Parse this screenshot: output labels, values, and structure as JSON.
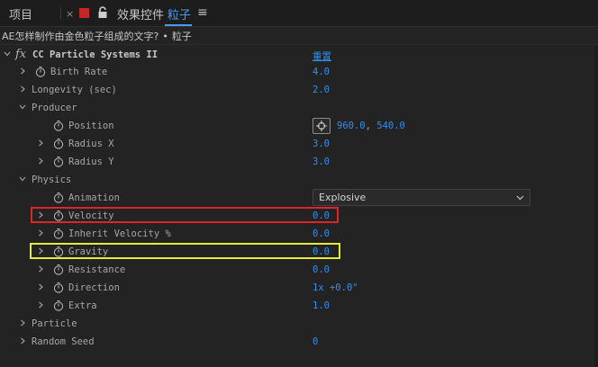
{
  "tabs": {
    "project": "项目",
    "close": "×",
    "effects": "效果控件",
    "layer": "粒子",
    "menu": "≡"
  },
  "breadcrumb": {
    "composition": "AE怎样制作由金色粒子组成的文字?",
    "separator": "•",
    "layer": "粒子"
  },
  "effect": {
    "name": "CC Particle Systems II",
    "reset": "重置",
    "fx": "fx"
  },
  "rows": [
    {
      "label": "Birth Rate",
      "value": "4.0"
    },
    {
      "label": "Longevity (sec)",
      "value": "2.0"
    },
    {
      "label": "Producer"
    },
    {
      "label": "Position",
      "value_x": "960.0",
      "value_comma": ",",
      "value_y": "540.0"
    },
    {
      "label": "Radius X",
      "value": "3.0"
    },
    {
      "label": "Radius Y",
      "value": "3.0"
    },
    {
      "label": "Physics"
    },
    {
      "label": "Animation",
      "value": "Explosive"
    },
    {
      "label": "Velocity",
      "value": "0.0"
    },
    {
      "label": "Inherit Velocity %",
      "value": "0.0"
    },
    {
      "label": "Gravity",
      "value": "0.0"
    },
    {
      "label": "Resistance",
      "value": "0.0"
    },
    {
      "label": "Direction",
      "value_rev": "1x",
      "value_deg": "+0.0°"
    },
    {
      "label": "Extra",
      "value": "1.0"
    },
    {
      "label": "Particle"
    },
    {
      "label": "Random Seed",
      "value": "0"
    }
  ],
  "colors": {
    "accent_blue": "#2f8ff1",
    "highlight_red": "#d8262a",
    "highlight_yellow": "#e3ec3b"
  }
}
